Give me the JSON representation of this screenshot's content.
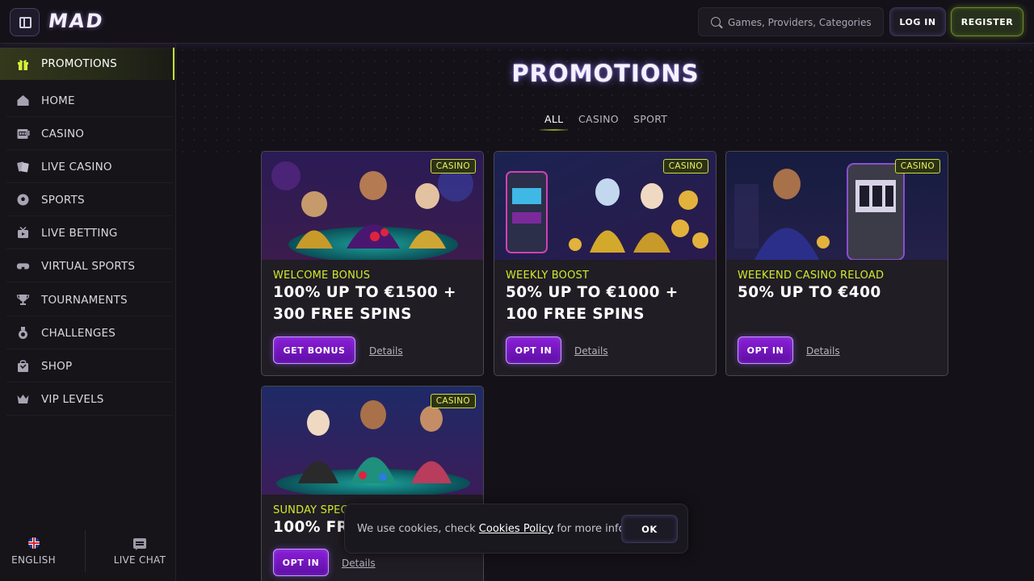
{
  "header": {
    "logo": "MAD",
    "search_placeholder": "Games, Providers, Categories",
    "login_label": "LOG IN",
    "register_label": "REGISTER"
  },
  "sidebar": {
    "items": [
      {
        "label": "PROMOTIONS",
        "icon": "gift-icon"
      },
      {
        "label": "HOME",
        "icon": "home-icon"
      },
      {
        "label": "CASINO",
        "icon": "slot-machine-icon"
      },
      {
        "label": "LIVE CASINO",
        "icon": "cards-icon"
      },
      {
        "label": "SPORTS",
        "icon": "soccer-ball-icon"
      },
      {
        "label": "LIVE BETTING",
        "icon": "tv-icon"
      },
      {
        "label": "VIRTUAL SPORTS",
        "icon": "vr-headset-icon"
      },
      {
        "label": "TOURNAMENTS",
        "icon": "trophy-icon"
      },
      {
        "label": "CHALLENGES",
        "icon": "medal-icon"
      },
      {
        "label": "SHOP",
        "icon": "shopping-bag-icon"
      },
      {
        "label": "VIP LEVELS",
        "icon": "crown-icon"
      }
    ],
    "language": "ENGLISH",
    "live_chat": "LIVE CHAT"
  },
  "main": {
    "title": "PROMOTIONS",
    "tabs": [
      "ALL",
      "CASINO",
      "SPORT"
    ],
    "cards": [
      {
        "badge": "CASINO",
        "subtitle": "WELCOME BONUS",
        "headline": "100% UP TO €1500 + 300 FREE SPINS",
        "cta": "GET BONUS",
        "details": "Details"
      },
      {
        "badge": "CASINO",
        "subtitle": "WEEKLY BOOST",
        "headline": "50% UP TO €1000 + 100 FREE SPINS",
        "cta": "OPT IN",
        "details": "Details"
      },
      {
        "badge": "CASINO",
        "subtitle": "WEEKEND CASINO RELOAD",
        "headline": "50% UP TO €400",
        "cta": "OPT IN",
        "details": "Details"
      },
      {
        "badge": "CASINO",
        "subtitle": "SUNDAY SPEC",
        "headline": "100% FRE",
        "cta": "OPT IN",
        "details": "Details"
      }
    ]
  },
  "cookie": {
    "text_before": "We use cookies, check",
    "link": "Cookies Policy",
    "text_after": "for more info.",
    "ok_label": "OK"
  },
  "colors": {
    "accent_lime": "#d0ea2a",
    "accent_purple": "#7b16c4",
    "background": "#141218"
  }
}
